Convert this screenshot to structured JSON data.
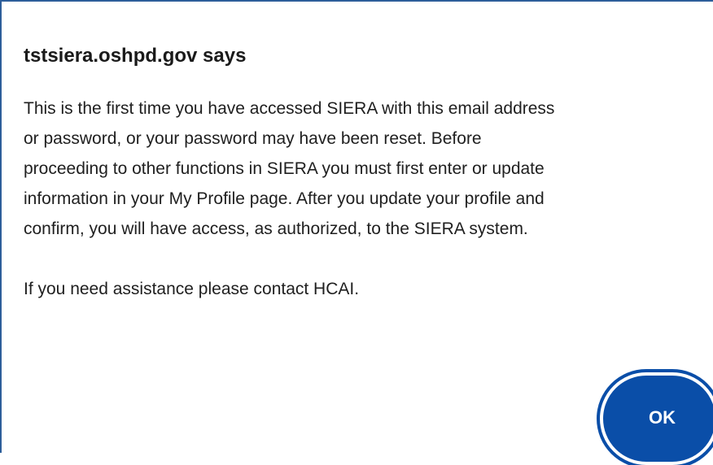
{
  "dialog": {
    "title": "tstsiera.oshpd.gov says",
    "message_lines": [
      "This is the first time you have accessed SIERA with this email address",
      "or password, or your password may have been reset. Before",
      "proceeding to other functions in SIERA you must first enter or update",
      "information in your My Profile page. After you update your profile and",
      "confirm, you will have access, as authorized, to the SIERA system."
    ],
    "assistance_text": "If you need assistance please contact HCAI.",
    "ok_label": "OK"
  },
  "colors": {
    "button_background": "#0a4ea8",
    "dialog_border": "#2d5e9a",
    "text": "#1f1f1f"
  }
}
